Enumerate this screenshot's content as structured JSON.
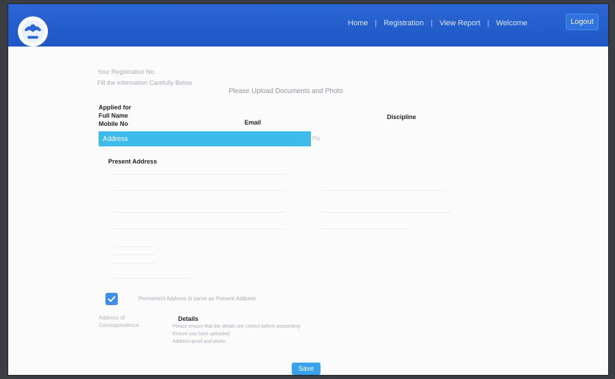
{
  "header": {
    "nav": [
      "Home",
      "Registration",
      "View Report",
      "Welcome"
    ],
    "logout_label": "Logout"
  },
  "form": {
    "reg_no_label": "Your Registration No.",
    "edit_hint": "Fill the information Carefully Below",
    "instruction": "Please Upload Documents and Photo",
    "applied_for_label": "Applied for",
    "full_name_label": "Full Name",
    "mobile_label": "Mobile No",
    "email_label": "Email",
    "discipline_label": "Discipline",
    "address_section": "Address",
    "side_label": "Pin",
    "present_address_label": "Present Address",
    "permanent_address_note": "Permanent Address is same as Present Address",
    "left_note_1": "Address of",
    "left_note_2": "Correspondence",
    "details_heading": "Details",
    "details_line_1": "Please ensure that the details are correct before proceeding",
    "details_line_2": "Ensure you have uploaded",
    "details_line_3": "Address proof and photo",
    "save_label": "Save"
  },
  "colors": {
    "topbar": "#2a66d4",
    "section_header": "#3dbbea",
    "checkbox": "#3f8fe8",
    "save_button": "#3aa2ec"
  }
}
